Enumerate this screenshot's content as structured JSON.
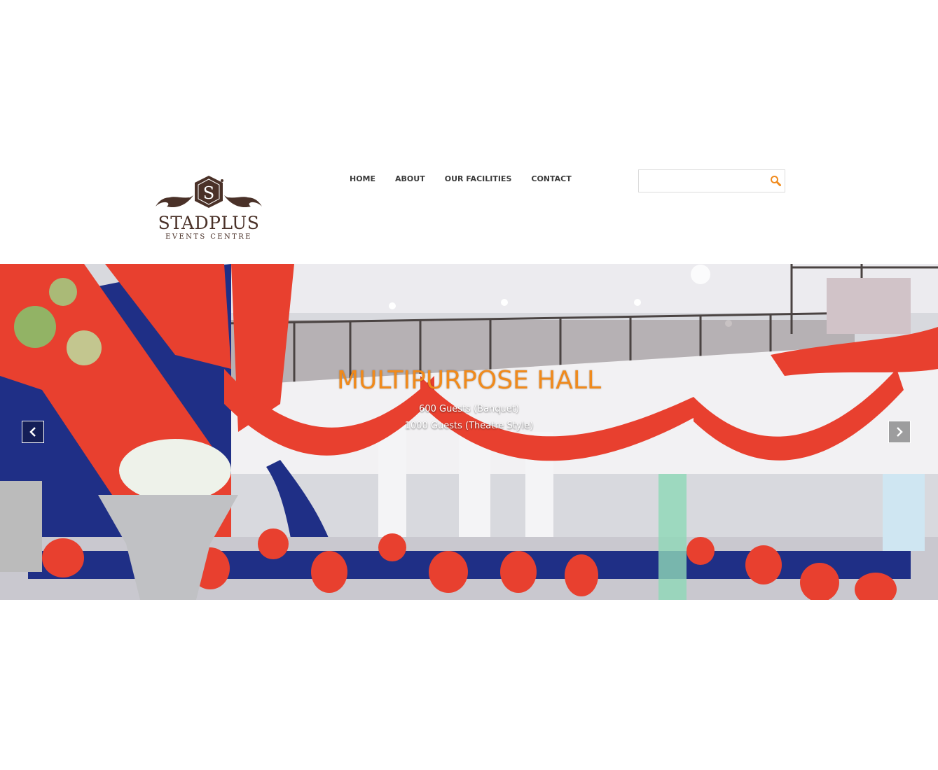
{
  "brand": {
    "name": "STADPLUS",
    "subtitle": "EVENTS CENTRE",
    "logo_color": "#4a3128"
  },
  "nav": {
    "items": [
      {
        "label": "HOME"
      },
      {
        "label": "ABOUT"
      },
      {
        "label": "OUR FACILITIES"
      },
      {
        "label": "CONTACT"
      }
    ]
  },
  "search": {
    "value": "",
    "placeholder": "",
    "icon": "search-icon",
    "icon_color": "#f08a1c"
  },
  "slider": {
    "title": "MULTIPURPOSE HALL",
    "title_color": "#f08a1c",
    "lines": [
      "600 Guests (Banquet)",
      "1000 Guests (Theatre Style)"
    ],
    "prev_icon": "chevron-left-icon",
    "next_icon": "chevron-right-icon",
    "drape_colors": [
      "#e8402f",
      "#1f2f86"
    ]
  }
}
